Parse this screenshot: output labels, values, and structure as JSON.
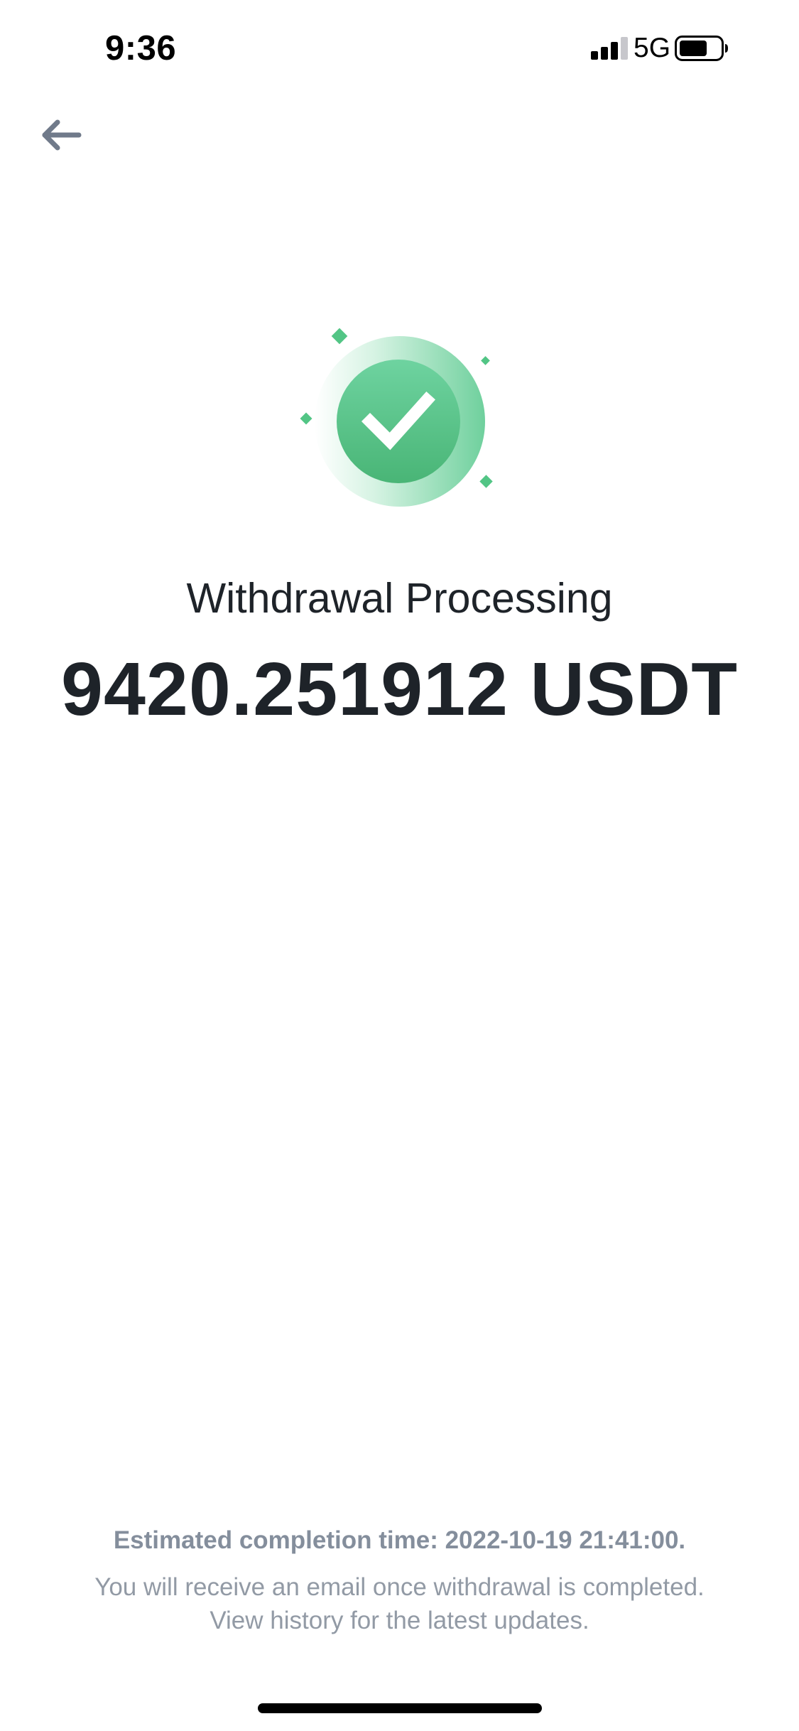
{
  "status_bar": {
    "time": "9:36",
    "network": "5G",
    "icons": [
      "signal-icon",
      "battery-icon"
    ]
  },
  "navigation": {
    "back_icon": "arrow-left-icon"
  },
  "result": {
    "icon": "check-circle-icon",
    "title": "Withdrawal Processing",
    "amount": "9420.251912 USDT"
  },
  "footer": {
    "estimated_time": "Estimated completion time: 2022-10-19 21:41:00.",
    "notice_line1": "You will receive an email once withdrawal is completed.",
    "notice_line2": "View history for the latest updates."
  },
  "colors": {
    "success_green": "#3ebd7a",
    "text_primary": "#1e2329",
    "text_secondary": "#848e9c",
    "icon_gray": "#707a8a"
  }
}
